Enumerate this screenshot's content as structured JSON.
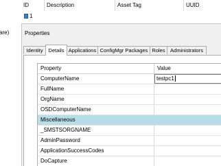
{
  "left_pane": {
    "fragment": "are)"
  },
  "grid": {
    "columns": [
      "ID",
      "Description",
      "Asset Tag",
      "UUID"
    ],
    "rows": [
      {
        "id": "1"
      }
    ]
  },
  "properties": {
    "title": "Properties",
    "tabs": [
      {
        "label": "Identity",
        "active": false
      },
      {
        "label": "Details",
        "active": true
      },
      {
        "label": "Applications",
        "active": false
      },
      {
        "label": "ConfigMgr Packages",
        "active": false
      },
      {
        "label": "Roles",
        "active": false
      },
      {
        "label": "Administrators",
        "active": false
      }
    ],
    "grid": {
      "headers": {
        "property": "Property",
        "value": "Value"
      },
      "rows": [
        {
          "name": "ComputerName",
          "value": "testpc1",
          "editing": true
        },
        {
          "name": "FullName",
          "value": ""
        },
        {
          "name": "OrgName",
          "value": ""
        },
        {
          "name": "OSDComputerName",
          "value": ""
        },
        {
          "name": "Miscellaneous",
          "value": "",
          "section": true
        },
        {
          "name": "_SMSTSORGNAME",
          "value": ""
        },
        {
          "name": "AdminPassword",
          "value": ""
        },
        {
          "name": "ApplicationSuccessCodes",
          "value": ""
        },
        {
          "name": "DoCapture",
          "value": ""
        }
      ]
    }
  },
  "colors": {
    "section_row": "#b7dde9",
    "row_icon": "#3d7fc4"
  }
}
